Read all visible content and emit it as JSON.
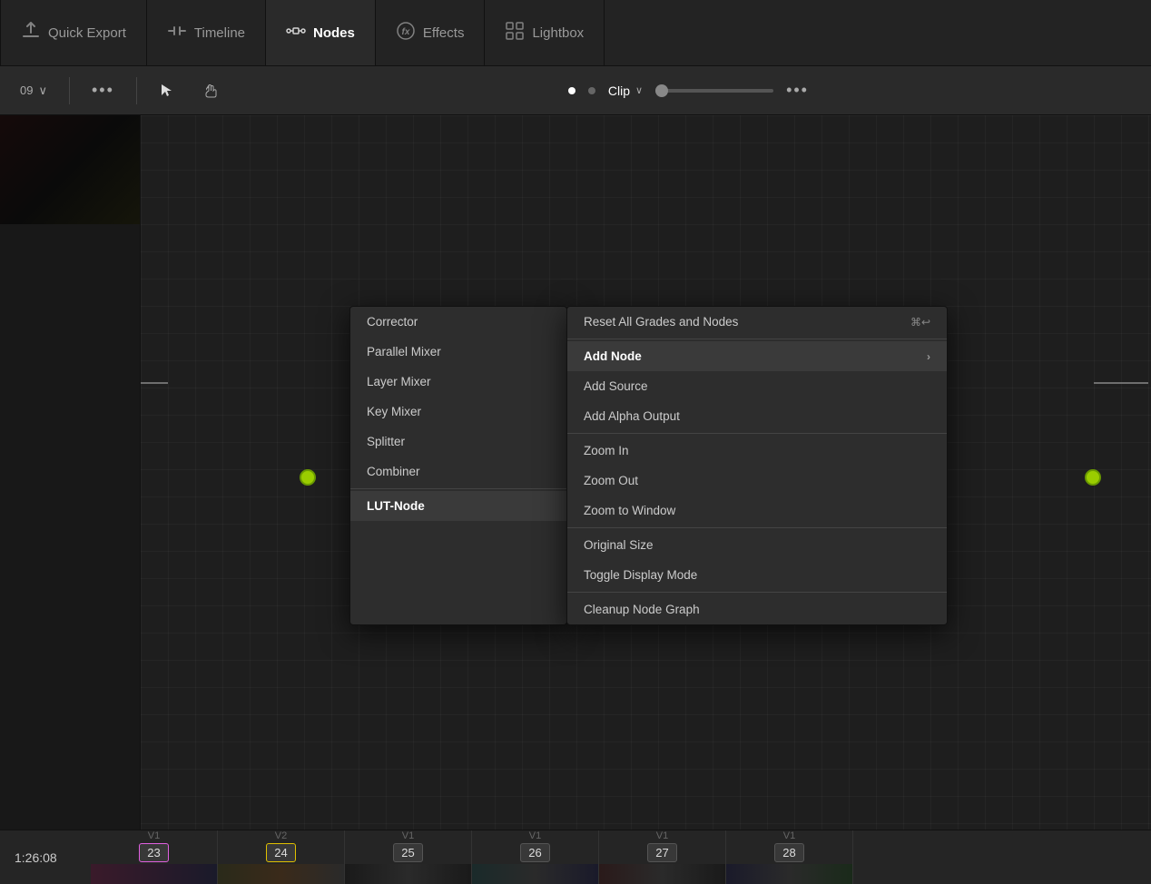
{
  "topNav": {
    "items": [
      {
        "id": "quick-export",
        "icon": "⬆",
        "label": "Quick Export",
        "active": false
      },
      {
        "id": "timeline",
        "icon": "⊣⊢",
        "label": "Timeline",
        "active": false
      },
      {
        "id": "nodes",
        "icon": "⊞",
        "label": "Nodes",
        "active": true
      },
      {
        "id": "effects",
        "icon": "fx",
        "label": "Effects",
        "active": false
      },
      {
        "id": "lightbox",
        "icon": "⊞⊞",
        "label": "Lightbox",
        "active": false
      }
    ]
  },
  "toolbar": {
    "dropdown_label": "09",
    "dots": "•••",
    "cursor_tool": "cursor",
    "hand_tool": "hand",
    "dot1_active": true,
    "dot2_dim": true,
    "clip_label": "Clip",
    "clip_arrow": "∨",
    "right_dots": "•••"
  },
  "contextMenuLeft": {
    "items": [
      {
        "id": "corrector",
        "label": "Corrector",
        "highlighted": false
      },
      {
        "id": "parallel-mixer",
        "label": "Parallel Mixer",
        "highlighted": false
      },
      {
        "id": "layer-mixer",
        "label": "Layer Mixer",
        "highlighted": false
      },
      {
        "id": "key-mixer",
        "label": "Key Mixer",
        "highlighted": false
      },
      {
        "id": "splitter",
        "label": "Splitter",
        "highlighted": false
      },
      {
        "id": "combiner",
        "label": "Combiner",
        "highlighted": false
      },
      {
        "id": "lut-node",
        "label": "LUT-Node",
        "highlighted": true
      }
    ]
  },
  "contextMenuRight": {
    "items": [
      {
        "id": "reset-all",
        "label": "Reset All Grades and Nodes",
        "shortcut": "⌘↩",
        "arrow": false,
        "dividerAfter": true
      },
      {
        "id": "add-node",
        "label": "Add Node",
        "shortcut": "",
        "arrow": true,
        "highlighted": true,
        "dividerAfter": false
      },
      {
        "id": "add-source",
        "label": "Add Source",
        "shortcut": "",
        "arrow": false,
        "dividerAfter": false
      },
      {
        "id": "add-alpha-output",
        "label": "Add Alpha Output",
        "shortcut": "",
        "arrow": false,
        "dividerAfter": true
      },
      {
        "id": "zoom-in",
        "label": "Zoom In",
        "shortcut": "",
        "arrow": false,
        "dividerAfter": false
      },
      {
        "id": "zoom-out",
        "label": "Zoom Out",
        "shortcut": "",
        "arrow": false,
        "dividerAfter": false
      },
      {
        "id": "zoom-to-window",
        "label": "Zoom to Window",
        "shortcut": "",
        "arrow": false,
        "dividerAfter": true
      },
      {
        "id": "original-size",
        "label": "Original Size",
        "shortcut": "",
        "arrow": false,
        "dividerAfter": false
      },
      {
        "id": "toggle-display",
        "label": "Toggle Display Mode",
        "shortcut": "",
        "arrow": false,
        "dividerAfter": true
      },
      {
        "id": "cleanup-node",
        "label": "Cleanup Node Graph",
        "shortcut": "",
        "arrow": false,
        "dividerAfter": false
      }
    ]
  },
  "timeline": {
    "timecode": "1:26:08",
    "clips": [
      {
        "track": "V1",
        "number": "23",
        "active": "pink"
      },
      {
        "track": "V2",
        "number": "24",
        "active": "yellow"
      },
      {
        "track": "V1",
        "number": "25",
        "active": "none"
      },
      {
        "track": "V1",
        "number": "26",
        "active": "none"
      },
      {
        "track": "V1",
        "number": "27",
        "active": "none"
      },
      {
        "track": "V1",
        "number": "28",
        "active": "none"
      }
    ]
  }
}
